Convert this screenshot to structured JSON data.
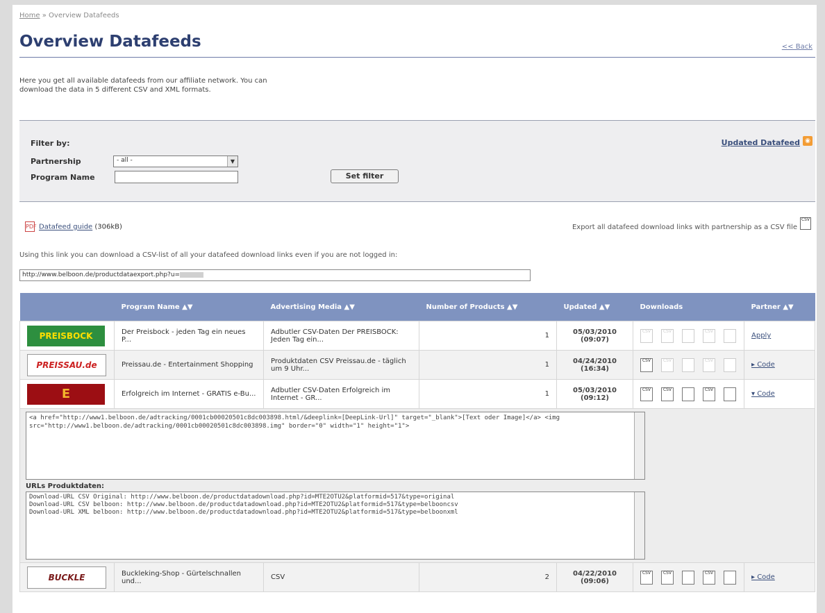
{
  "breadcrumb": {
    "home": "Home",
    "sep": "»",
    "current": "Overview Datafeeds"
  },
  "page": {
    "title": "Overview Datafeeds",
    "back": "<< Back",
    "intro": "Here you get all available datafeeds from our affiliate network. You can download the data in 5 different CSV and XML formats."
  },
  "filter": {
    "heading": "Filter by:",
    "partnership_label": "Partnership",
    "partnership_value": "- all -",
    "program_label": "Program Name",
    "program_value": "",
    "set_filter": "Set filter",
    "updated_link": "Updated Datafeed"
  },
  "guide": {
    "link": "Datafeed guide",
    "size": "(306kB)",
    "pdf_icon": "PDF"
  },
  "export": {
    "text": "Export all datafeed download links with partnership as a CSV file"
  },
  "note": "Using this link you can download a CSV-list of all your datafeed download links even if you are not logged in:",
  "export_url": "http://www.belboon.de/productdataexport.php?u=",
  "table": {
    "headers": [
      "",
      "Program Name ▲▼",
      "Advertising Media ▲▼",
      "Number of Products ▲▼",
      "Updated ▲▼",
      "Downloads",
      "Partner ▲▼"
    ],
    "rows": [
      {
        "logo": "PREISBOCK",
        "program": "Der Preisbock - jeden Tag ein neues P...",
        "media": "Adbutler CSV-Daten Der PREISBOCK: Jeden Tag ein...",
        "count": "1",
        "date": "05/03/2010",
        "time": "(09:07)",
        "partner": "Apply"
      },
      {
        "logo": "PREISSAU.de",
        "program": "Preissau.de - Entertainment Shopping",
        "media": "Produktdaten CSV Preissau.de - täglich um 9 Uhr...",
        "count": "1",
        "date": "04/24/2010",
        "time": "(16:34)",
        "partner": "▸ Code"
      },
      {
        "logo": "E",
        "program": "Erfolgreich im Internet - GRATIS e-Bu...",
        "media": "Adbutler CSV-Daten Erfolgreich im Internet - GR...",
        "count": "1",
        "date": "05/03/2010",
        "time": "(09:12)",
        "partner": "▾ Code"
      },
      {
        "logo": "BUCKLE",
        "program": "Buckleking-Shop - Gürtelschnallen und...",
        "media": "CSV",
        "count": "2",
        "date": "04/22/2010",
        "time": "(09:06)",
        "partner": "▸ Code"
      }
    ],
    "code": "<a href=\"http://www1.belboon.de/adtracking/0001cb00020501c8dc003898.html/&deeplink=[DeepLink-Url]\" target=\"_blank\">[Text oder Image]</a> <img src=\"http://www1.belboon.de/adtracking/0001cb00020501c8dc003898.img\" border=\"0\" width=\"1\" height=\"1\">",
    "urls_heading": "URLs Produktdaten:",
    "urls": "Download-URL CSV Original: http://www.belboon.de/productdatadownload.php?id=MTE2OTU2&platformid=517&type=original\nDownload-URL CSV belboon: http://www.belboon.de/productdatadownload.php?id=MTE2OTU2&platformid=517&type=belbooncsv\nDownload-URL XML belboon: http://www.belboon.de/productdatadownload.php?id=MTE2OTU2&platformid=517&type=belboonxml"
  },
  "icons": {
    "csv": "CSV",
    "rss": "rss-icon"
  },
  "colors": {
    "header": "#7f93c0",
    "title": "#2d3f70"
  }
}
